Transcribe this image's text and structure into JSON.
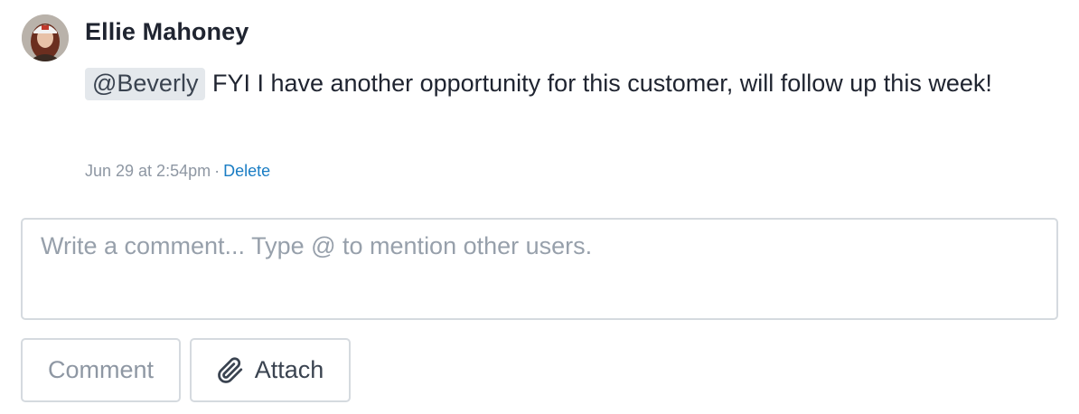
{
  "comment": {
    "author": "Ellie Mahoney",
    "avatar_icon": "user-avatar-photo",
    "mention": "@Beverly",
    "text": " FYI I have another opportunity for this customer, will follow up this week!",
    "timestamp": "Jun 29 at 2:54pm",
    "separator": "·",
    "delete_label": "Delete"
  },
  "composer": {
    "placeholder": "Write a comment... Type @ to mention other users.",
    "value": ""
  },
  "actions": {
    "comment_label": "Comment",
    "attach_label": "Attach",
    "attach_icon": "paperclip-icon"
  },
  "colors": {
    "link": "#1a7dc4",
    "mention_bg": "#e4e8ec",
    "border": "#d5dadf",
    "muted_text": "#8e97a3"
  }
}
